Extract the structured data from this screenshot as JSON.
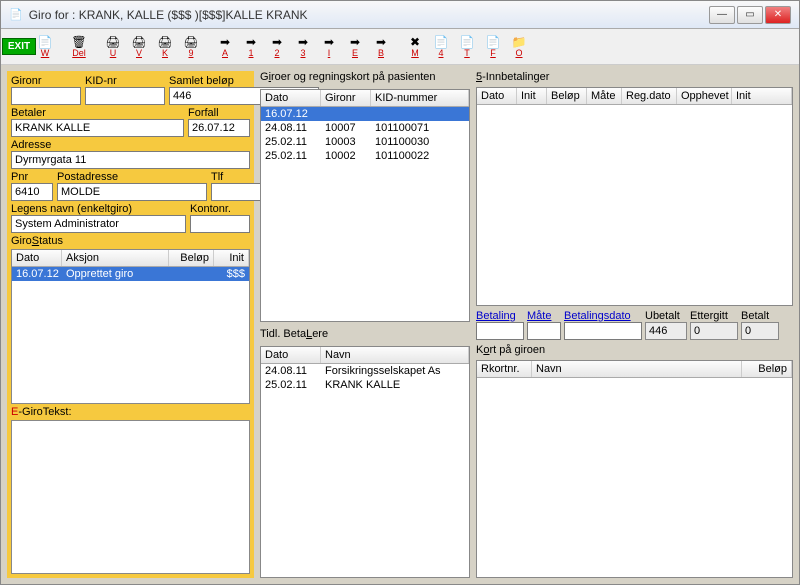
{
  "title": "Giro for : KRANK, KALLE ($$$ )[$$$]KALLE KRANK",
  "toolbar": {
    "exit": "EXIT",
    "items": [
      "W",
      "",
      "Del",
      "",
      "U",
      "V",
      "K",
      "9",
      "",
      "A",
      "1",
      "2",
      "3",
      "I",
      "E",
      "B",
      "",
      "M",
      "4",
      "T",
      "F",
      "O"
    ]
  },
  "left": {
    "gironr_lbl": "Gironr",
    "kid_lbl": "KID-nr",
    "samlet_lbl": "Samlet beløp",
    "samlet_val": "446",
    "betaler_lbl": "Betaler",
    "betaler_val": "KRANK KALLE",
    "forfall_lbl": "Forfall",
    "forfall_val": "26.07.12",
    "adresse_lbl": "Adresse",
    "adresse_val": "Dyrmyrgata 11",
    "pnr_lbl": "Pnr",
    "pnr_val": "6410",
    "postadr_lbl": "Postadresse",
    "postadr_val": "MOLDE",
    "tlf_lbl": "Tlf",
    "legens_lbl": "Legens navn (enkeltgiro)",
    "legens_val": "System Administrator",
    "kontonr_lbl": "Kontonr.",
    "girostatus_lbl": "GiroStatus",
    "gs_cols": [
      "Dato",
      "Aksjon",
      "Beløp",
      "Init"
    ],
    "gs_rows": [
      {
        "dato": "16.07.12",
        "aksjon": "Opprettet giro",
        "belop": "",
        "init": "$$$"
      }
    ],
    "egiro_lbl": "E-GiroTekst:"
  },
  "mid": {
    "giroer_lbl": "Giroer og regningskort på pasienten",
    "g_cols": [
      "Dato",
      "Gironr",
      "KID-nummer"
    ],
    "g_rows": [
      {
        "dato": "16.07.12",
        "gironr": "",
        "kid": "",
        "sel": true
      },
      {
        "dato": "24.08.11",
        "gironr": "10007",
        "kid": "101100071"
      },
      {
        "dato": "25.02.11",
        "gironr": "10003",
        "kid": "101100030"
      },
      {
        "dato": "25.02.11",
        "gironr": "10002",
        "kid": "101100022"
      }
    ],
    "tidl_lbl": "Tidl. BetaLere",
    "t_cols": [
      "Dato",
      "Navn"
    ],
    "t_rows": [
      {
        "dato": "24.08.11",
        "navn": "Forsikringsselskapet As"
      },
      {
        "dato": "25.02.11",
        "navn": "KRANK KALLE"
      }
    ]
  },
  "right": {
    "innbet_lbl": "5-Innbetalinger",
    "i_cols": [
      "Dato",
      "Init",
      "Beløp",
      "Måte",
      "Reg.dato",
      "Opphevet",
      "Init"
    ],
    "links": {
      "betaling": "Betaling",
      "mate": "Måte",
      "betdato": "Betalingsdato"
    },
    "ubetalt_lbl": "Ubetalt",
    "ubetalt_val": "446",
    "ettergitt_lbl": "Ettergitt",
    "ettergitt_val": "0",
    "betalt_lbl": "Betalt",
    "betalt_val": "0",
    "kort_lbl": "Kort på giroen",
    "k_cols": [
      "Rkortnr.",
      "Navn",
      "Beløp"
    ]
  }
}
